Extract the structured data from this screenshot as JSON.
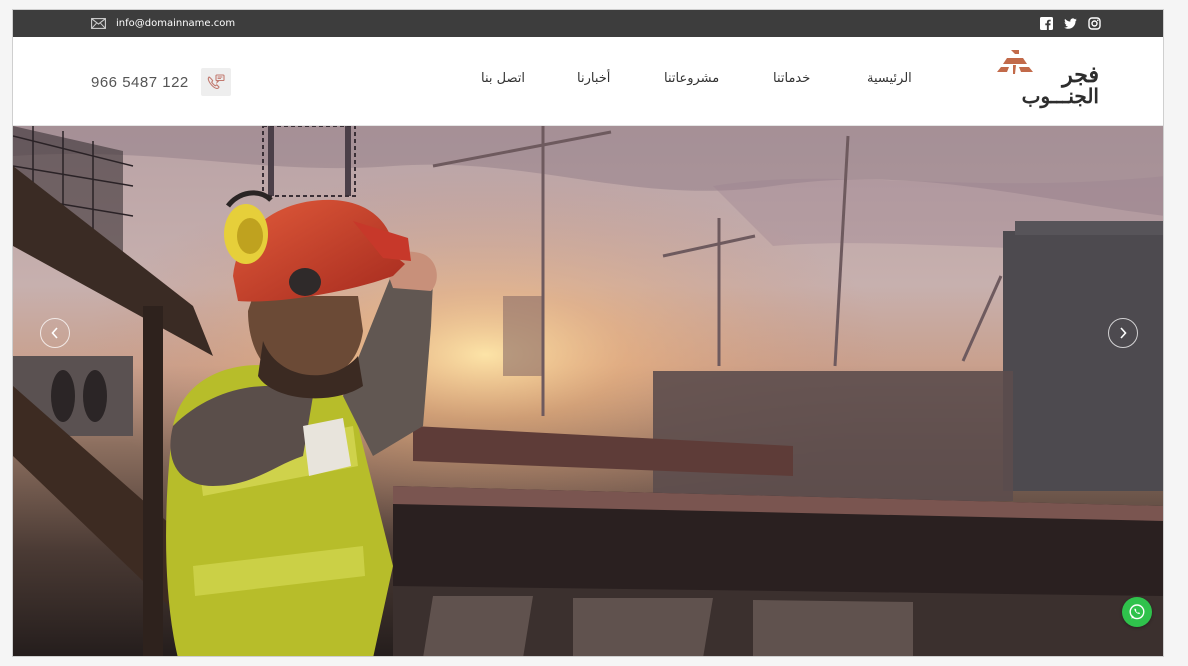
{
  "topbar": {
    "email": "info@domainname.com",
    "socials": [
      "facebook-icon",
      "twitter-icon",
      "instagram-icon"
    ]
  },
  "header": {
    "phone": "966 5487 122",
    "nav": {
      "home": "الرئيسية",
      "services": "خدماتنا",
      "projects": "مشروعاتنا",
      "news": "أخبارنا",
      "contact": "اتصل بنا"
    },
    "logo": {
      "line1": "فجر",
      "line2": "الجنـــوب"
    }
  },
  "colors": {
    "topbar": "#3d3d3d",
    "logo_accent": "#c26a4a",
    "whatsapp": "#2fc24c"
  }
}
